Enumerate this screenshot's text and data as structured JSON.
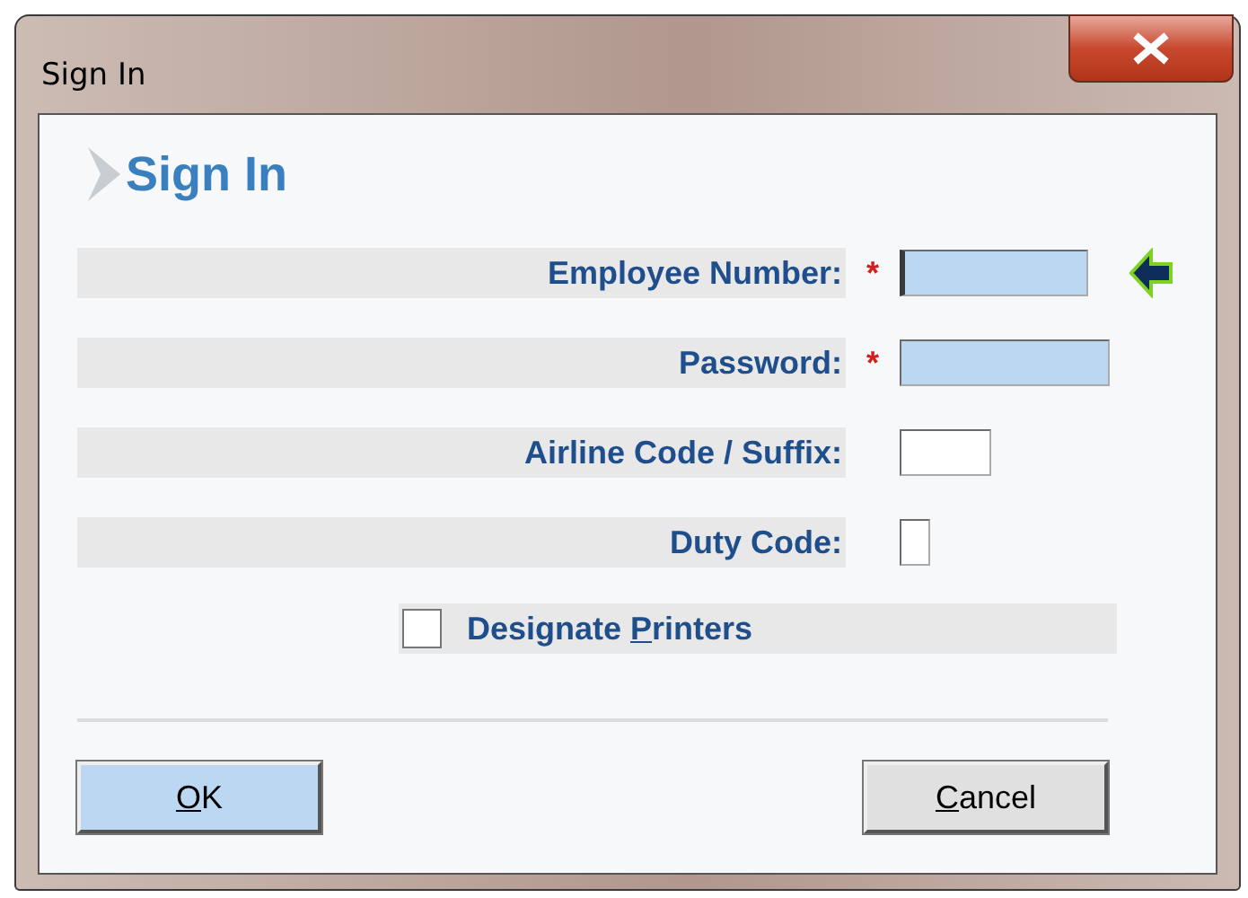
{
  "window": {
    "title": "Sign In"
  },
  "heading": "Sign In",
  "fields": [
    {
      "label": "Employee Number:",
      "required": true,
      "highlighted": true,
      "current": true
    },
    {
      "label": "Password:",
      "required": true,
      "highlighted": true,
      "current": false
    },
    {
      "label": "Airline Code / Suffix:",
      "required": false,
      "highlighted": false,
      "current": false
    },
    {
      "label": "Duty Code:",
      "required": false,
      "highlighted": false,
      "current": false
    }
  ],
  "required_mark": "*",
  "designate_printers": {
    "label_parts": [
      {
        "text": "Designate ",
        "underlined": false
      },
      {
        "text": "P",
        "underlined": true
      },
      {
        "text": "rinters",
        "underlined": false
      }
    ],
    "checked": false
  },
  "buttons": [
    {
      "label_parts": [
        {
          "text": "O",
          "underlined": true
        },
        {
          "text": "K",
          "underlined": false
        }
      ],
      "kind": "default"
    },
    {
      "label_parts": [
        {
          "text": "C",
          "underlined": true
        },
        {
          "text": "ancel",
          "underlined": false
        }
      ],
      "kind": "normal"
    }
  ]
}
